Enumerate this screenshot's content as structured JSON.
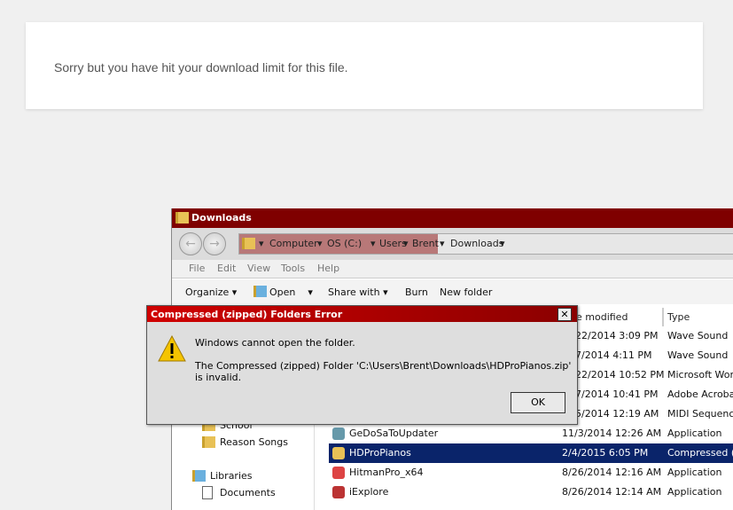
{
  "page": {
    "message": "Sorry but you have hit your download limit for this file."
  },
  "explorer": {
    "title": "Downloads",
    "breadcrumb": [
      "Computer",
      "OS (C:)",
      "Users",
      "Brent",
      "Downloads"
    ],
    "menu": [
      "File",
      "Edit",
      "View",
      "Tools",
      "Help"
    ],
    "toolbar": {
      "organize": "Organize",
      "open": "Open",
      "share": "Share with",
      "burn": "Burn",
      "new_folder": "New folder"
    },
    "nav": {
      "school": "School",
      "reason": "Reason Songs",
      "libraries": "Libraries",
      "documents": "Documents"
    },
    "columns": {
      "date": "e modified",
      "type": "Type"
    },
    "rows": [
      {
        "name": "",
        "date": "22/2014 3:09 PM",
        "type": "Wave Sound"
      },
      {
        "name": "",
        "date": "7/2014 4:11 PM",
        "type": "Wave Sound"
      },
      {
        "name": "",
        "date": "22/2014 10:52 PM",
        "type": "Microsoft Word"
      },
      {
        "name": "",
        "date": "7/2014 10:41 PM",
        "type": "Adobe Acrobat"
      },
      {
        "name": "",
        "date": "5/2014 12:19 AM",
        "type": "MIDI Sequence"
      },
      {
        "name": "GeDoSaToUpdater",
        "date": "11/3/2014 12:26 AM",
        "type": "Application"
      },
      {
        "name": "HDProPianos",
        "date": "2/4/2015 6:05 PM",
        "type": "Compressed (zip"
      },
      {
        "name": "HitmanPro_x64",
        "date": "8/26/2014 12:16 AM",
        "type": "Application"
      },
      {
        "name": "iExplore",
        "date": "8/26/2014 12:14 AM",
        "type": "Application"
      }
    ],
    "selected_color": "#0a246a"
  },
  "dialog": {
    "title": "Compressed (zipped) Folders Error",
    "line1": "Windows cannot open the folder.",
    "line2": "The Compressed (zipped) Folder 'C:\\Users\\Brent\\Downloads\\HDProPianos.zip' is invalid.",
    "ok": "OK",
    "close": "✕",
    "icon": "warning-icon"
  }
}
